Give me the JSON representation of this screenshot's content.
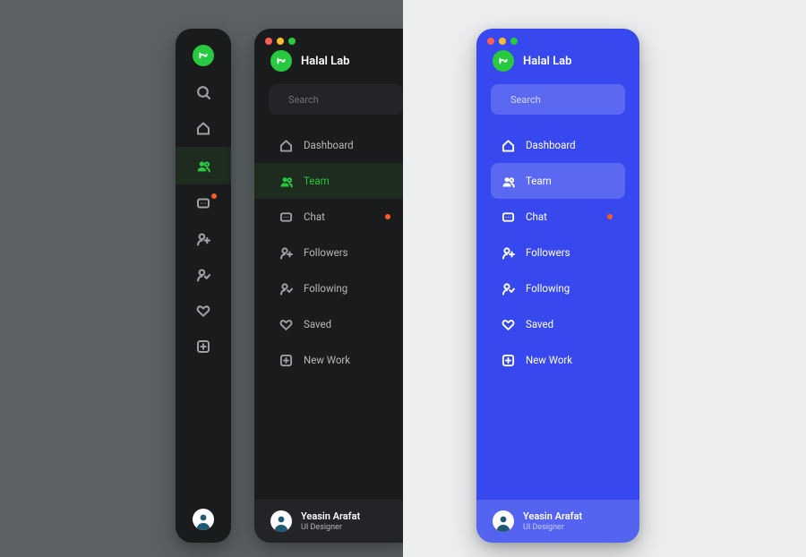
{
  "colors": {
    "dark": "#1a1b1d",
    "blue": "#3848ef",
    "accent_green": "#28c840",
    "badge": "#ff5b22"
  },
  "brand": {
    "name": "Halal Lab"
  },
  "search": {
    "placeholder": "Search"
  },
  "nav": {
    "items": [
      {
        "key": "dashboard",
        "label": "Dashboard",
        "active": false,
        "badge": false
      },
      {
        "key": "team",
        "label": "Team",
        "active": true,
        "badge": false
      },
      {
        "key": "chat",
        "label": "Chat",
        "active": false,
        "badge": true
      },
      {
        "key": "followers",
        "label": "Followers",
        "active": false,
        "badge": false
      },
      {
        "key": "following",
        "label": "Following",
        "active": false,
        "badge": false
      },
      {
        "key": "saved",
        "label": "Saved",
        "active": false,
        "badge": false
      },
      {
        "key": "newwork",
        "label": "New Work",
        "active": false,
        "badge": false
      }
    ]
  },
  "user": {
    "name": "Yeasin Arafat",
    "role": "UI Designer"
  }
}
